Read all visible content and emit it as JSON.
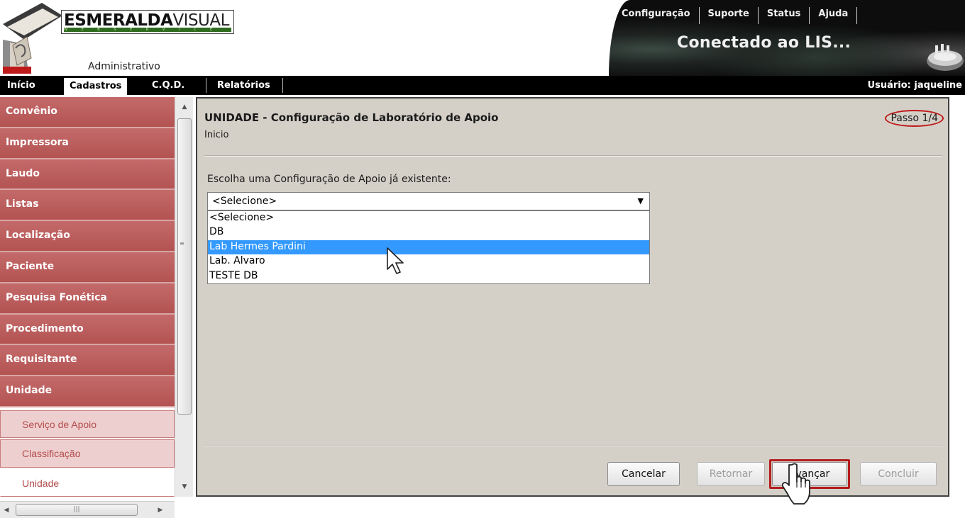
{
  "header": {
    "logo_text_bold": "ESMERALDA",
    "logo_text_light": "VISUAL",
    "logo_tagline": "W E B   S E R V I C E",
    "module": "Administrativo",
    "top_menu": [
      "Configuração",
      "Suporte",
      "Status",
      "Ajuda"
    ],
    "connection_status": "Conectado ao LIS..."
  },
  "navbar": {
    "items": [
      "Início",
      "Cadastros",
      "C.Q.D.",
      "Relatórios"
    ],
    "active": "Cadastros",
    "user": "Usuário: jaqueline"
  },
  "sidebar": {
    "items": [
      "Convênio",
      "Impressora",
      "Laudo",
      "Listas",
      "Localização",
      "Paciente",
      "Pesquisa Fonética",
      "Procedimento",
      "Requisitante",
      "Unidade"
    ],
    "subitems": [
      "Serviço de Apoio",
      "Classificação",
      "Unidade"
    ],
    "current_subitem": "Unidade"
  },
  "panel": {
    "title": "UNIDADE - Configuração de Laboratório de Apoio",
    "subtitle": "Inicio",
    "step": "Passo 1/4",
    "select_label": "Escolha uma Configuração de Apoio já existente:",
    "select_value": "<Selecione>",
    "options": [
      "<Selecione>",
      "DB",
      "Lab Hermes Pardini",
      "Lab. Alvaro",
      "TESTE DB"
    ],
    "highlighted_option": "Lab Hermes Pardini",
    "buttons": {
      "cancelar": "Cancelar",
      "retornar": "Retornar",
      "avancar": "Avançar",
      "concluir": "Concluir"
    }
  },
  "colors": {
    "sidebar_red": "#b35352",
    "highlight_blue": "#3399ff",
    "panel_bg": "#d4d0c8",
    "annotation_red": "#c01818"
  }
}
